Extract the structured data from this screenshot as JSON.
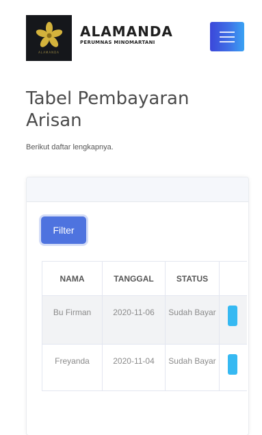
{
  "header": {
    "brand_title": "ALAMANDA",
    "brand_subtitle": "PERUMNAS MINOMARTANI",
    "logo_caption": "ALAMANDA",
    "menu_icon": "hamburger-icon",
    "colors": {
      "menu_gradient_start": "#3b47d9",
      "menu_gradient_end": "#3aa2f3",
      "logo_bg": "#15171b",
      "logo_flower": "#d4b33c"
    }
  },
  "main": {
    "title": "Tabel Pembayaran Arisan",
    "description": "Berikut daftar lengkapnya.",
    "filter_label": "Filter",
    "accent": "#4e73df",
    "table": {
      "columns": [
        "NAMA",
        "TANGGAL",
        "STATUS"
      ],
      "rows": [
        {
          "nama": "Bu Firman",
          "tanggal": "2020-11-06",
          "status": "Sudah Bayar"
        },
        {
          "nama": "Freyanda",
          "tanggal": "2020-11-04",
          "status": "Sudah Bayar"
        }
      ]
    }
  }
}
